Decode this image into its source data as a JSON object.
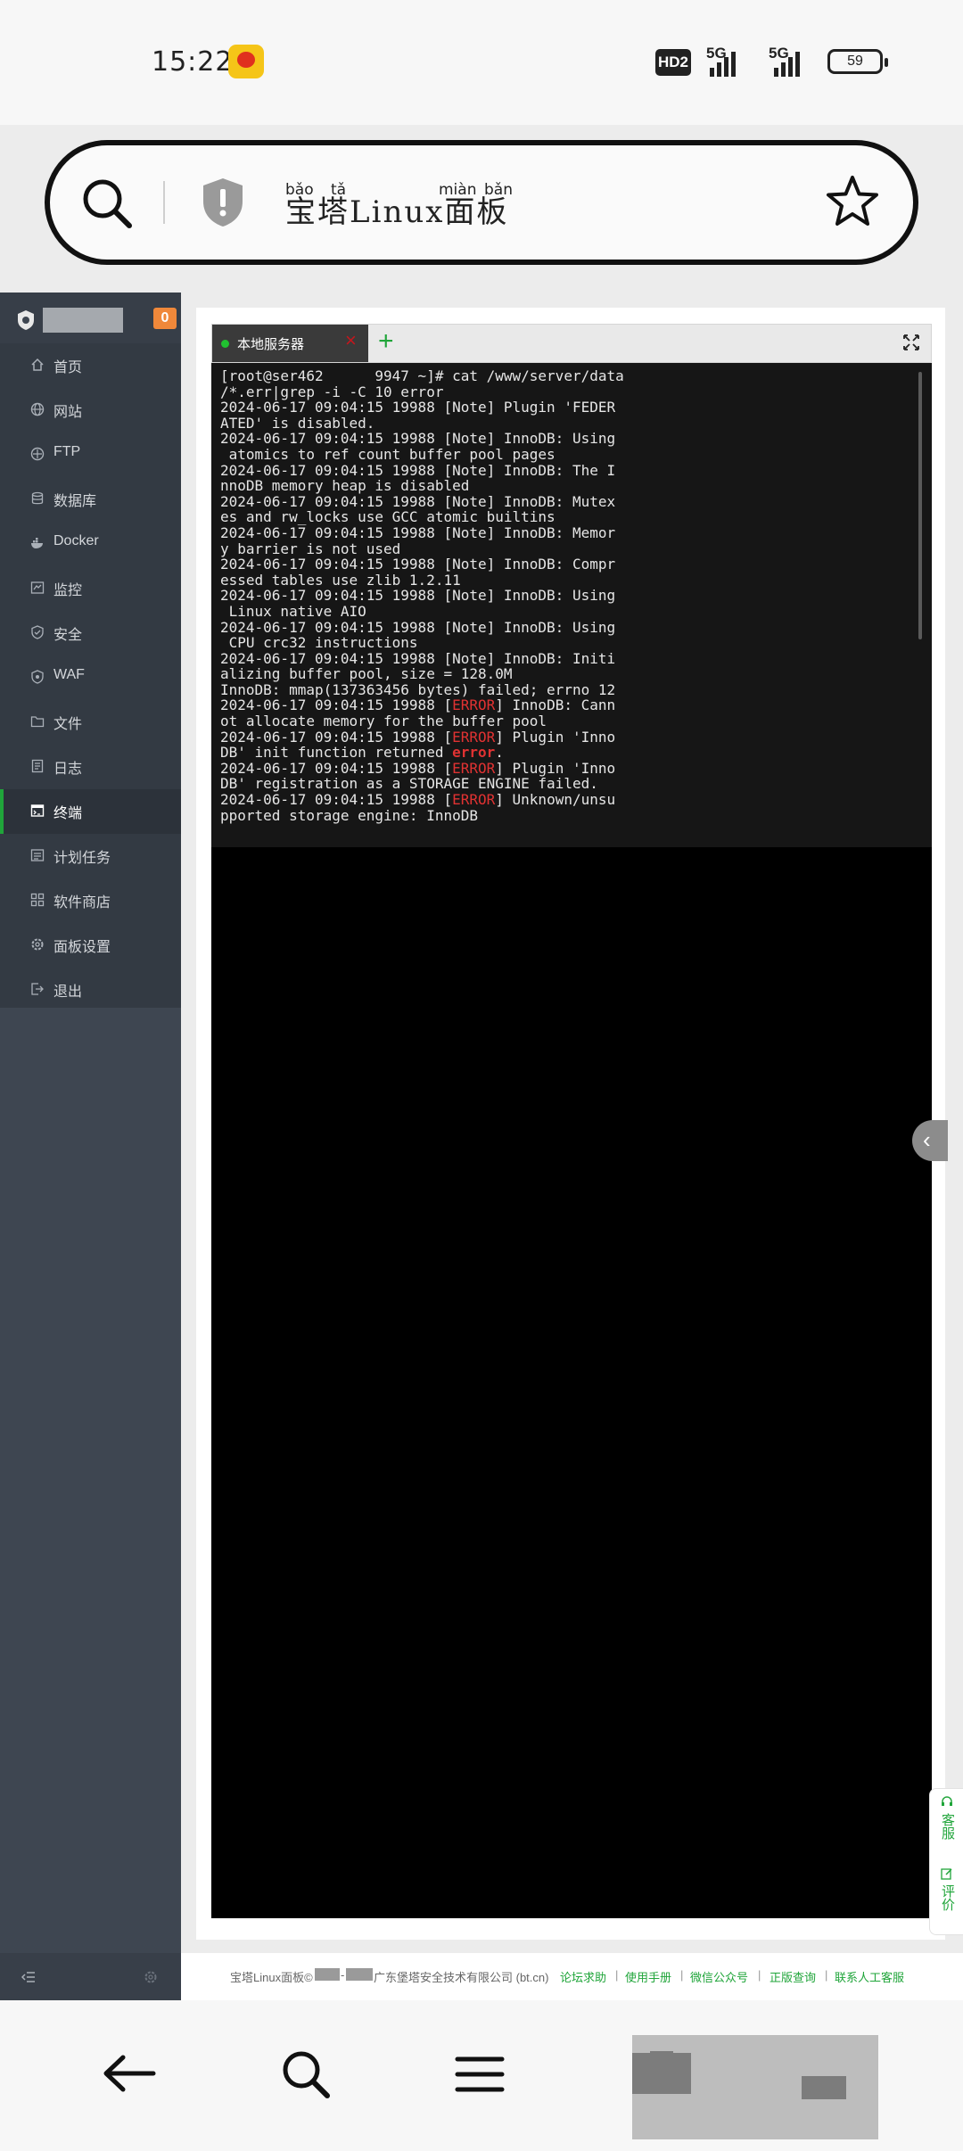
{
  "status_bar": {
    "time": "15:22",
    "network_badge": "HD2",
    "signal1": "5G",
    "signal2": "5G",
    "battery": "59"
  },
  "browser": {
    "address_title": "宝塔Linux面板",
    "pinyin": [
      "bǎo",
      "tǎ",
      "miàn",
      "bǎn"
    ]
  },
  "sidebar": {
    "badge": "0",
    "items": [
      {
        "label": "首页",
        "icon": "home-icon"
      },
      {
        "label": "网站",
        "icon": "globe-icon"
      },
      {
        "label": "FTP",
        "icon": "ftp-icon"
      },
      {
        "label": "数据库",
        "icon": "database-icon"
      },
      {
        "label": "Docker",
        "icon": "docker-icon"
      },
      {
        "label": "监控",
        "icon": "monitor-icon"
      },
      {
        "label": "安全",
        "icon": "shield-icon"
      },
      {
        "label": "WAF",
        "icon": "waf-shield-icon"
      },
      {
        "label": "文件",
        "icon": "folder-icon"
      },
      {
        "label": "日志",
        "icon": "log-icon"
      },
      {
        "label": "终端",
        "icon": "terminal-icon"
      },
      {
        "label": "计划任务",
        "icon": "task-icon"
      },
      {
        "label": "软件商店",
        "icon": "apps-icon"
      },
      {
        "label": "面板设置",
        "icon": "settings-icon"
      },
      {
        "label": "退出",
        "icon": "logout-icon"
      }
    ],
    "active": "终端"
  },
  "terminal": {
    "tab_label": "本地服务器",
    "lines": [
      {
        "parts": [
          {
            "t": "[root@ser462"
          },
          {
            "t": "      ",
            "mask": true
          },
          {
            "t": "9947 ~]# cat /www/server/data"
          }
        ]
      },
      {
        "parts": [
          {
            "t": "/*.err|grep -i -C 10 error"
          }
        ]
      },
      {
        "parts": [
          {
            "t": "2024-06-17 09:04:15 19988 [Note] Plugin 'FEDER"
          }
        ]
      },
      {
        "parts": [
          {
            "t": "ATED' is disabled."
          }
        ]
      },
      {
        "parts": [
          {
            "t": "2024-06-17 09:04:15 19988 [Note] InnoDB: Using"
          }
        ]
      },
      {
        "parts": [
          {
            "t": " atomics to ref count buffer pool pages"
          }
        ]
      },
      {
        "parts": [
          {
            "t": "2024-06-17 09:04:15 19988 [Note] InnoDB: The I"
          }
        ]
      },
      {
        "parts": [
          {
            "t": "nnoDB memory heap is disabled"
          }
        ]
      },
      {
        "parts": [
          {
            "t": "2024-06-17 09:04:15 19988 [Note] InnoDB: Mutex"
          }
        ]
      },
      {
        "parts": [
          {
            "t": "es and rw_locks use GCC atomic builtins"
          }
        ]
      },
      {
        "parts": [
          {
            "t": "2024-06-17 09:04:15 19988 [Note] InnoDB: Memor"
          }
        ]
      },
      {
        "parts": [
          {
            "t": "y barrier is not used"
          }
        ]
      },
      {
        "parts": [
          {
            "t": "2024-06-17 09:04:15 19988 [Note] InnoDB: Compr"
          }
        ]
      },
      {
        "parts": [
          {
            "t": "essed tables use zlib 1.2.11"
          }
        ]
      },
      {
        "parts": [
          {
            "t": "2024-06-17 09:04:15 19988 [Note] InnoDB: Using"
          }
        ]
      },
      {
        "parts": [
          {
            "t": " Linux native AIO"
          }
        ]
      },
      {
        "parts": [
          {
            "t": "2024-06-17 09:04:15 19988 [Note] InnoDB: Using"
          }
        ]
      },
      {
        "parts": [
          {
            "t": " CPU crc32 instructions"
          }
        ]
      },
      {
        "parts": [
          {
            "t": "2024-06-17 09:04:15 19988 [Note] InnoDB: Initi"
          }
        ]
      },
      {
        "parts": [
          {
            "t": "alizing buffer pool, size = 128.0M"
          }
        ]
      },
      {
        "parts": [
          {
            "t": "InnoDB: mmap(137363456 bytes) failed; errno 12"
          }
        ]
      },
      {
        "parts": [
          {
            "t": "2024-06-17 09:04:15 19988 ["
          },
          {
            "t": "ERROR",
            "err": true
          },
          {
            "t": "] InnoDB: Cann"
          }
        ]
      },
      {
        "parts": [
          {
            "t": "ot allocate memory for the buffer pool"
          }
        ]
      },
      {
        "parts": [
          {
            "t": "2024-06-17 09:04:15 19988 ["
          },
          {
            "t": "ERROR",
            "err": true
          },
          {
            "t": "] Plugin 'Inno"
          }
        ]
      },
      {
        "parts": [
          {
            "t": "DB' init function returned "
          },
          {
            "t": "error",
            "errw": true
          },
          {
            "t": "."
          }
        ]
      },
      {
        "parts": [
          {
            "t": "2024-06-17 09:04:15 19988 ["
          },
          {
            "t": "ERROR",
            "err": true
          },
          {
            "t": "] Plugin 'Inno"
          }
        ]
      },
      {
        "parts": [
          {
            "t": "DB' registration as a STORAGE ENGINE failed."
          }
        ]
      },
      {
        "parts": [
          {
            "t": "2024-06-17 09:04:15 19988 ["
          },
          {
            "t": "ERROR",
            "err": true
          },
          {
            "t": "] Unknown/unsu"
          }
        ]
      },
      {
        "parts": [
          {
            "t": "pported storage engine: InnoDB"
          }
        ]
      }
    ]
  },
  "right_dock": {
    "service": "客服",
    "review": "评价"
  },
  "footer": {
    "copyright_prefix": "宝塔Linux面板©",
    "copyright_sep": "-",
    "company": "广东堡塔安全技术有限公司 (bt.cn)",
    "links": [
      "论坛求助",
      "使用手册",
      "微信公众号",
      "正版查询",
      "联系人工客服"
    ],
    "separator": "|"
  },
  "colors": {
    "accent": "#20a53a",
    "error": "#e03232",
    "sidebar": "#3e4651",
    "badge": "#f0883a"
  }
}
